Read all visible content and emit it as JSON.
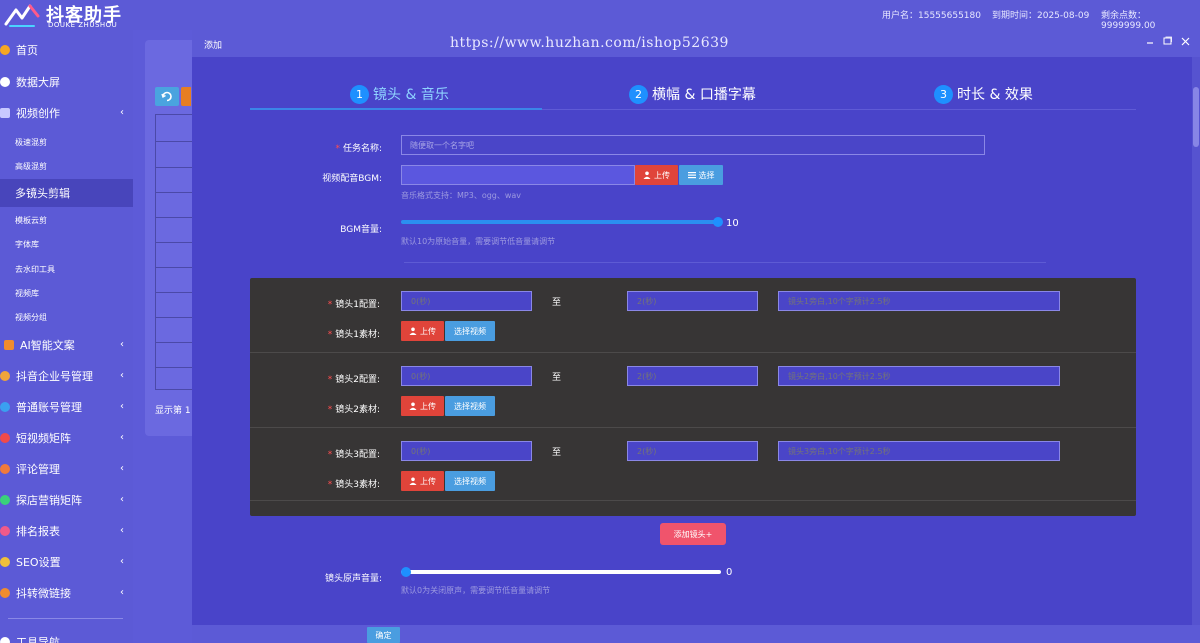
{
  "header": {
    "logo_title": "抖客助手",
    "logo_sub": "DOUKE ZHUSHOU",
    "username": "用户名：15555655180",
    "expire": "到期时间：2025-08-09",
    "points": "剩余点数：9999999.00"
  },
  "sidebar": {
    "items": [
      {
        "label": "首页",
        "color": "#f5a623"
      },
      {
        "label": "数据大屏",
        "color": "#ffffff"
      },
      {
        "label": "视频创作",
        "color": "#c8c8ff",
        "chevron": "‹"
      },
      {
        "label": "极速混剪",
        "color": ""
      },
      {
        "label": "高级混剪",
        "color": ""
      },
      {
        "label": "多镜头剪辑",
        "color": ""
      },
      {
        "label": "模板云剪",
        "color": ""
      },
      {
        "label": "字体库",
        "color": ""
      },
      {
        "label": "去水印工具",
        "color": ""
      },
      {
        "label": "视频库",
        "color": ""
      },
      {
        "label": "视频分组",
        "color": ""
      },
      {
        "label": "AI智能文案",
        "color": "#f08c2e",
        "chevron": "‹"
      },
      {
        "label": "抖音企业号管理",
        "color": "#f0a53a",
        "chevron": "‹"
      },
      {
        "label": "普通账号管理",
        "color": "#3aa0f0",
        "chevron": "‹"
      },
      {
        "label": "短视频矩阵",
        "color": "#f04a4a",
        "chevron": "‹"
      },
      {
        "label": "评论管理",
        "color": "#f07a3a",
        "chevron": "‹"
      },
      {
        "label": "探店营销矩阵",
        "color": "#3ad07a",
        "chevron": "‹"
      },
      {
        "label": "排名报表",
        "color": "#f05a8a",
        "chevron": "‹"
      },
      {
        "label": "SEO设置",
        "color": "#f0c03a",
        "chevron": "‹"
      },
      {
        "label": "抖转微链接",
        "color": "#f08c2e",
        "chevron": "‹"
      },
      {
        "label": "工具导航",
        "color": "#ffffff"
      }
    ]
  },
  "background": {
    "footer_text": "显示第 1"
  },
  "modal": {
    "title": "添加",
    "watermark": "https://www.huzhan.com/ishop52639",
    "steps": [
      {
        "num": "1",
        "label": "镜头 & 音乐"
      },
      {
        "num": "2",
        "label": "横幅 & 口播字幕"
      },
      {
        "num": "3",
        "label": "时长 & 效果"
      }
    ],
    "task_name": {
      "label": "任务名称:",
      "placeholder": "随便取一个名字吧"
    },
    "bgm": {
      "label": "视频配音BGM:",
      "upload": "上传",
      "select": "选择",
      "help": "音乐格式支持：MP3、ogg、wav"
    },
    "bgm_volume": {
      "label": "BGM音量:",
      "value": "10",
      "level": 1.0,
      "help": "默认10为原始音量，需要调节低音量请调节"
    },
    "shots": [
      {
        "config_label": "镜头1配置:",
        "start_placeholder": "0(秒)",
        "to": "至",
        "end_placeholder": "2(秒)",
        "text_placeholder": "镜头1旁白,10个字预计2.5秒",
        "material_label": "镜头1素材:",
        "upload": "上传",
        "select": "选择视频"
      },
      {
        "config_label": "镜头2配置:",
        "start_placeholder": "0(秒)",
        "to": "至",
        "end_placeholder": "2(秒)",
        "text_placeholder": "镜头2旁白,10个字预计2.5秒",
        "material_label": "镜头2素材:",
        "upload": "上传",
        "select": "选择视频"
      },
      {
        "config_label": "镜头3配置:",
        "start_placeholder": "0(秒)",
        "to": "至",
        "end_placeholder": "2(秒)",
        "text_placeholder": "镜头3旁白,10个字预计2.5秒",
        "material_label": "镜头3素材:",
        "upload": "上传",
        "select": "选择视频"
      }
    ],
    "add_shot": "添加镜头+",
    "orig_volume": {
      "label": "镜头原声音量:",
      "value": "0",
      "level": 0.0,
      "help": "默认0为关闭原声，需要调节低音量请调节"
    },
    "confirm": "确定"
  },
  "colors": {
    "primary": "#5c5ad6",
    "modal_bg": "#4944c9",
    "shots_bg": "#373535",
    "danger": "#e0443a",
    "info": "#4a9de0",
    "pink": "#f0546c",
    "step_active": "#8fd3ff"
  }
}
